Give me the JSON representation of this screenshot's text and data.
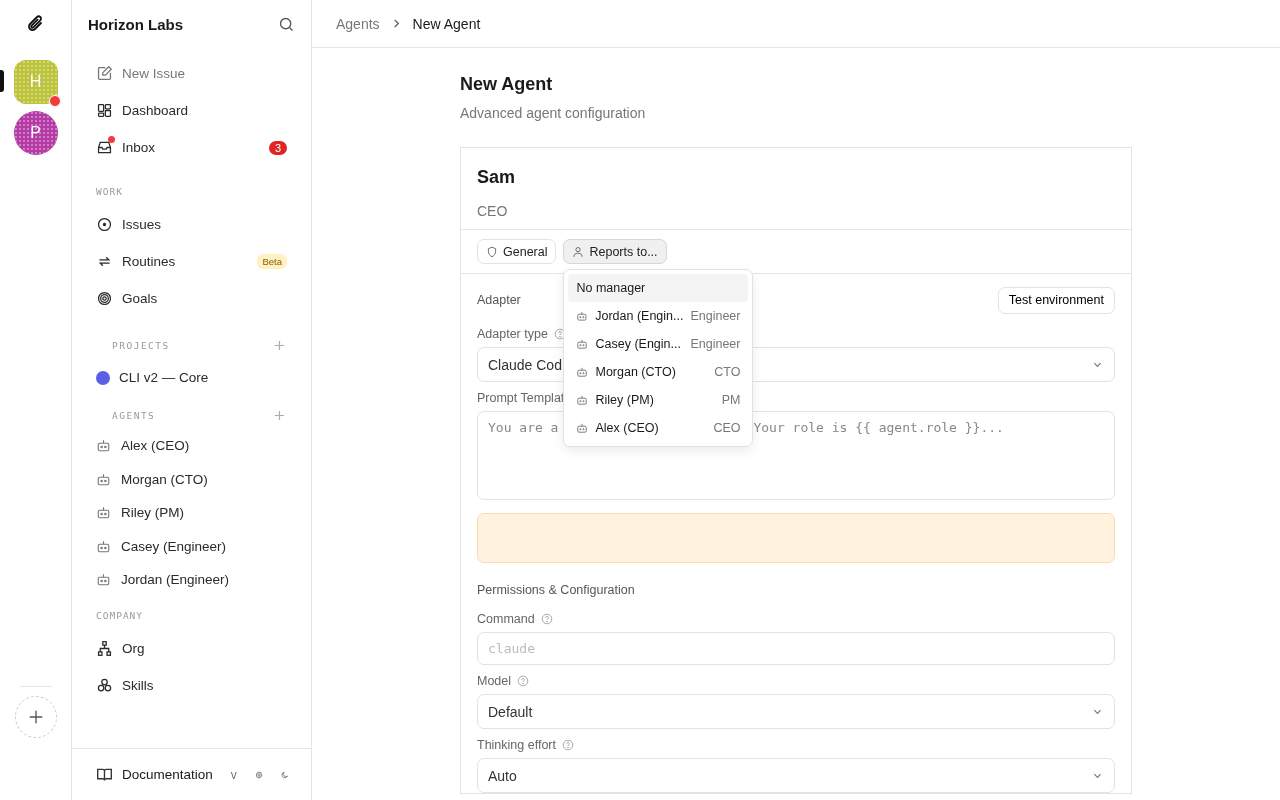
{
  "rail": {
    "workspaces": [
      {
        "initial": "H",
        "color": "#bcc23a",
        "selected": true,
        "notification": true
      },
      {
        "initial": "P",
        "color": "#b43aa5",
        "selected": false,
        "notification": false
      }
    ]
  },
  "sidebar": {
    "title": "Horizon Labs",
    "top_items": [
      {
        "label": "New Issue",
        "kind": "edit",
        "muted": true
      },
      {
        "label": "Dashboard",
        "kind": "dashboard",
        "muted": false
      },
      {
        "label": "Inbox",
        "kind": "inbox",
        "muted": false,
        "count": "3",
        "dot": true
      }
    ],
    "work": {
      "label": "WORK",
      "items": [
        {
          "label": "Issues",
          "kind": "issues"
        },
        {
          "label": "Routines",
          "kind": "routines",
          "badge": "Beta"
        },
        {
          "label": "Goals",
          "kind": "goals"
        }
      ]
    },
    "projects": {
      "label": "PROJECTS",
      "items": [
        {
          "label": "CLI v2 — Core",
          "color": "#5b5fe6"
        }
      ]
    },
    "agents": {
      "label": "AGENTS",
      "items": [
        {
          "label": "Alex (CEO)"
        },
        {
          "label": "Morgan (CTO)"
        },
        {
          "label": "Riley (PM)"
        },
        {
          "label": "Casey (Engineer)"
        },
        {
          "label": "Jordan (Engineer)"
        }
      ]
    },
    "company": {
      "label": "COMPANY",
      "items": [
        {
          "label": "Org",
          "kind": "org"
        },
        {
          "label": "Skills",
          "kind": "skills"
        }
      ]
    },
    "footer": {
      "docs": "Documentation",
      "version": "v"
    }
  },
  "breadcrumb": [
    "Agents",
    "New Agent"
  ],
  "page": {
    "title": "New Agent",
    "subtitle": "Advanced agent configuration"
  },
  "card": {
    "name": "Sam",
    "role": "CEO",
    "chips": [
      {
        "label": "General",
        "kind": "shield",
        "open": false
      },
      {
        "label": "Reports to...",
        "kind": "person",
        "open": true
      }
    ],
    "dropdown": [
      {
        "label": "No manager",
        "kind": "none",
        "selected": true
      },
      {
        "label": "Jordan (Engin...",
        "role": "Engineer",
        "kind": "agent",
        "selected": false
      },
      {
        "label": "Casey (Engin...",
        "role": "Engineer",
        "kind": "agent",
        "selected": false
      },
      {
        "label": "Morgan (CTO)",
        "role": "CTO",
        "kind": "agent",
        "selected": false
      },
      {
        "label": "Riley (PM)",
        "role": "PM",
        "kind": "agent",
        "selected": false
      },
      {
        "label": "Alex (CEO)",
        "role": "CEO",
        "kind": "agent",
        "selected": false
      }
    ],
    "sections": [
      {
        "title": "Adapter",
        "action": "Test environment",
        "fields": [
          {
            "kind": "select",
            "label": "Adapter type",
            "help": true,
            "value": "Claude Cod"
          },
          {
            "kind": "textarea",
            "label": "Prompt Templat",
            "placeholder_parts": [
              "You are a",
              "Your role is {{ agent.role }}..."
            ]
          },
          {
            "kind": "notice"
          }
        ]
      },
      {
        "title": "Permissions & Configuration",
        "fields": [
          {
            "kind": "input",
            "label": "Command",
            "help": true,
            "placeholder": "claude"
          },
          {
            "kind": "select",
            "label": "Model",
            "help": true,
            "value": "Default"
          },
          {
            "kind": "select",
            "label": "Thinking effort",
            "help": true,
            "value": "Auto"
          }
        ]
      }
    ]
  }
}
